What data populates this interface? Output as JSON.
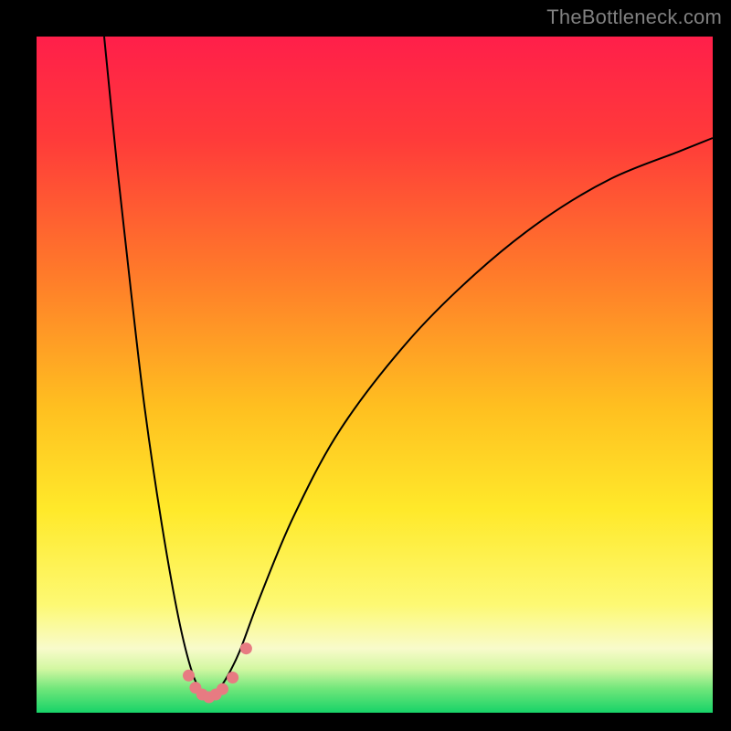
{
  "watermark": "TheBottleneck.com",
  "colors": {
    "frame_bg": "#000000",
    "curve_stroke": "#000000",
    "marker_fill": "#e77b82",
    "marker_stroke": "#d55a62",
    "gradient_stops": [
      {
        "offset": 0.0,
        "color": "#ff1f4a"
      },
      {
        "offset": 0.15,
        "color": "#ff3a3a"
      },
      {
        "offset": 0.35,
        "color": "#ff7a2a"
      },
      {
        "offset": 0.55,
        "color": "#ffc020"
      },
      {
        "offset": 0.7,
        "color": "#ffe92a"
      },
      {
        "offset": 0.84,
        "color": "#fdf973"
      },
      {
        "offset": 0.905,
        "color": "#f8fbcb"
      },
      {
        "offset": 0.935,
        "color": "#d3f7a2"
      },
      {
        "offset": 0.965,
        "color": "#6fe67a"
      },
      {
        "offset": 1.0,
        "color": "#17d368"
      }
    ]
  },
  "chart_data": {
    "type": "line",
    "title": "",
    "xlabel": "",
    "ylabel": "",
    "xlim": [
      0,
      100
    ],
    "ylim": [
      0,
      100
    ],
    "grid": false,
    "series": [
      {
        "name": "bottleneck-curve",
        "x": [
          10,
          12,
          14,
          16,
          18.5,
          21,
          23,
          24.5,
          25.5,
          26.5,
          28,
          30,
          33,
          38,
          45,
          55,
          65,
          75,
          85,
          95,
          100
        ],
        "y": [
          100,
          80,
          62,
          45,
          28,
          14,
          6,
          3,
          2,
          3,
          5,
          9,
          17,
          29,
          42,
          55,
          65,
          73,
          79,
          83,
          85
        ]
      }
    ],
    "markers": {
      "name": "highlighted-points",
      "x": [
        22.5,
        23.5,
        24.5,
        25.5,
        26.5,
        27.5,
        29.0,
        31.0
      ],
      "y": [
        5.5,
        3.7,
        2.7,
        2.3,
        2.7,
        3.5,
        5.2,
        9.5
      ]
    }
  }
}
